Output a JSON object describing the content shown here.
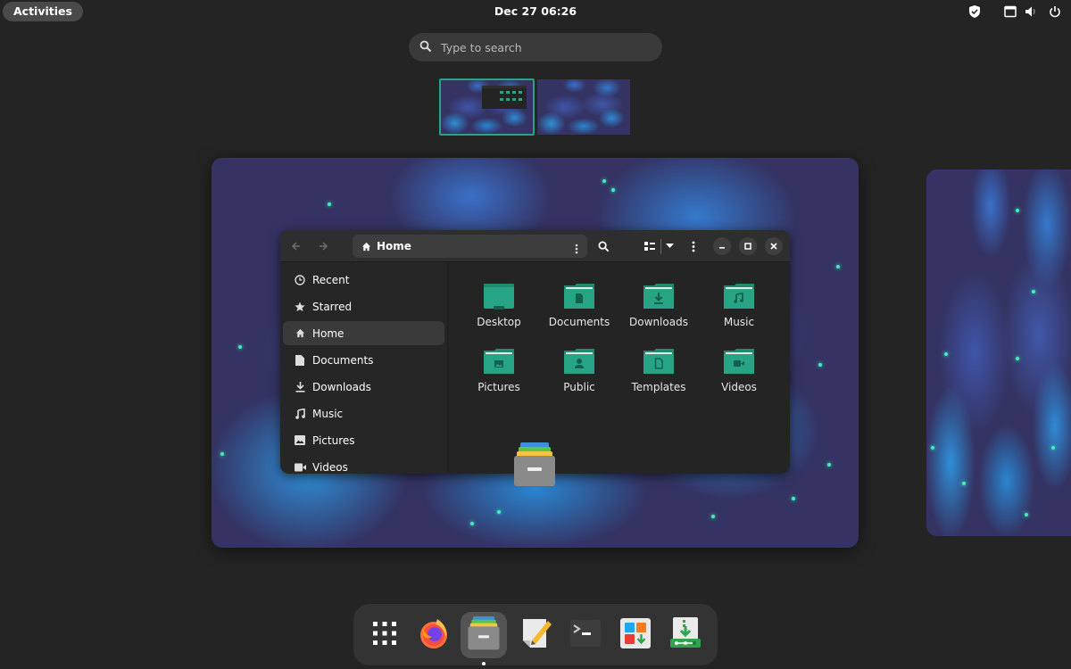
{
  "topbar": {
    "activities_label": "Activities",
    "clock": "Dec 27  06:26",
    "tray_icons": [
      "shield-check-icon",
      "screen-share-icon",
      "volume-icon",
      "power-icon"
    ]
  },
  "search": {
    "placeholder": "Type to search",
    "icon": "search-icon"
  },
  "workspaces": {
    "count": 2,
    "active_index": 0,
    "accent_color": "#26a484"
  },
  "file_manager": {
    "path_label": "Home",
    "path_icon": "home-icon",
    "header_buttons": [
      "back",
      "forward",
      "path-menu",
      "search",
      "view-list",
      "view-dropdown",
      "main-menu",
      "minimize",
      "maximize",
      "close"
    ],
    "sidebar": {
      "items": [
        {
          "label": "Recent",
          "icon": "clock-icon",
          "selected": false
        },
        {
          "label": "Starred",
          "icon": "star-icon",
          "selected": false
        },
        {
          "label": "Home",
          "icon": "home-icon",
          "selected": true
        },
        {
          "label": "Documents",
          "icon": "document-icon",
          "selected": false
        },
        {
          "label": "Downloads",
          "icon": "download-icon",
          "selected": false
        },
        {
          "label": "Music",
          "icon": "music-icon",
          "selected": false
        },
        {
          "label": "Pictures",
          "icon": "image-icon",
          "selected": false
        },
        {
          "label": "Videos",
          "icon": "video-icon",
          "selected": false
        }
      ]
    },
    "folders": [
      {
        "label": "Desktop",
        "glyph": "desktop"
      },
      {
        "label": "Documents",
        "glyph": "document"
      },
      {
        "label": "Downloads",
        "glyph": "download"
      },
      {
        "label": "Music",
        "glyph": "music"
      },
      {
        "label": "Pictures",
        "glyph": "image"
      },
      {
        "label": "Public",
        "glyph": "person"
      },
      {
        "label": "Templates",
        "glyph": "template"
      },
      {
        "label": "Videos",
        "glyph": "video"
      }
    ],
    "folder_color": "#26a484"
  },
  "dock": {
    "items": [
      {
        "name": "show-apps",
        "label": "Show Applications"
      },
      {
        "name": "firefox",
        "label": "Firefox"
      },
      {
        "name": "files",
        "label": "Files",
        "active": true,
        "running": true
      },
      {
        "name": "text-editor",
        "label": "Text Editor"
      },
      {
        "name": "terminal",
        "label": "Terminal"
      },
      {
        "name": "software",
        "label": "Software"
      },
      {
        "name": "extension-manager",
        "label": "Extension Manager"
      }
    ]
  }
}
